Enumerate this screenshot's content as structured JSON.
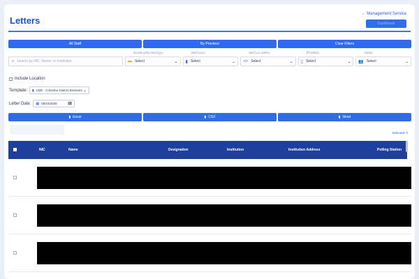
{
  "header": {
    "title": "Letters",
    "management_link": "← Management Service",
    "management_button": "Dashboard"
  },
  "tabs": [
    {
      "label": "All Staff"
    },
    {
      "label": "By Province"
    },
    {
      "label": "Clear Filters"
    }
  ],
  "search": {
    "placeholder": "Search by NIC, Name, or Institution"
  },
  "filters": [
    {
      "label": "ආයතන ප්‍රදේශ කාර්යාලය",
      "value": "Select",
      "icon": "folder-icon"
    },
    {
      "label": "කොට්ඨාශය",
      "value": "Select",
      "icon": "trash-icon"
    },
    {
      "label": "කොට්ඨාශ කේතය",
      "value": "Select",
      "icon": "code-icon"
    },
    {
      "label": "පිටපත්කරු",
      "value": "Select",
      "icon": "phone-icon"
    },
    {
      "label": "තනතුර",
      "value": "Select",
      "icon": "users-icon"
    }
  ],
  "include_location": {
    "label": "Include Location"
  },
  "template": {
    "label": "Template:",
    "value": "CDE - Colombo District Elections"
  },
  "letter_date": {
    "label": "Letter Date:",
    "value": "05/10/2025"
  },
  "exports": [
    {
      "label": "Excel"
    },
    {
      "label": "CSV"
    },
    {
      "label": "Word"
    }
  ],
  "selected_count": "Selected: 0",
  "table": {
    "columns": [
      "NIC",
      "Name",
      "Designation",
      "Institution",
      "Institution Address",
      "Polling Station"
    ],
    "row_count_visible": 3
  },
  "colors": {
    "accent": "#2e6cea",
    "header_bg": "#1e3f9b",
    "title": "#1f4fd1"
  }
}
